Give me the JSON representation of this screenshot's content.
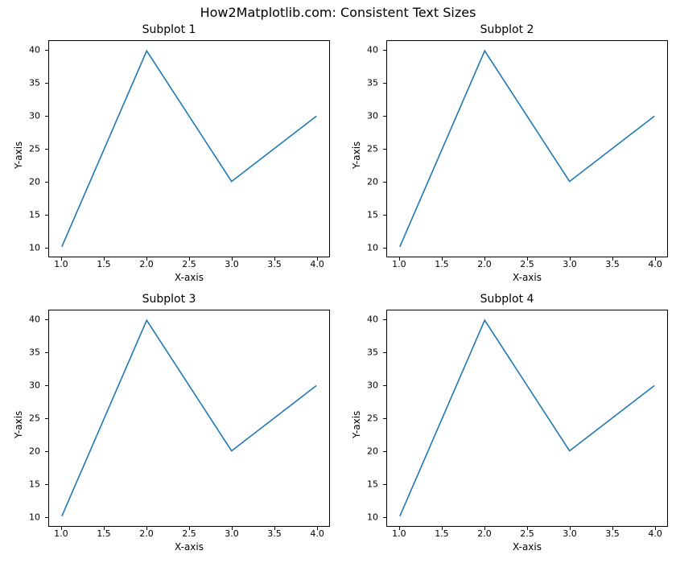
{
  "suptitle": "How2Matplotlib.com: Consistent Text Sizes",
  "xlabel": "X-axis",
  "ylabel": "Y-axis",
  "line_color": "#1f77b4",
  "subplot_titles": [
    "Subplot 1",
    "Subplot 2",
    "Subplot 3",
    "Subplot 4"
  ],
  "xticks": [
    "1.0",
    "1.5",
    "2.0",
    "2.5",
    "3.0",
    "3.5",
    "4.0"
  ],
  "yticks": [
    "10",
    "15",
    "20",
    "25",
    "30",
    "35",
    "40"
  ],
  "xlim": [
    1.0,
    4.0
  ],
  "ylim": [
    10,
    40
  ],
  "chart_data": [
    {
      "type": "line",
      "title": "Subplot 1",
      "xlabel": "X-axis",
      "ylabel": "Y-axis",
      "xlim": [
        1.0,
        4.0
      ],
      "ylim": [
        10,
        40
      ],
      "x": [
        1,
        2,
        3,
        4
      ],
      "y": [
        10,
        40,
        20,
        30
      ]
    },
    {
      "type": "line",
      "title": "Subplot 2",
      "xlabel": "X-axis",
      "ylabel": "Y-axis",
      "xlim": [
        1.0,
        4.0
      ],
      "ylim": [
        10,
        40
      ],
      "x": [
        1,
        2,
        3,
        4
      ],
      "y": [
        10,
        40,
        20,
        30
      ]
    },
    {
      "type": "line",
      "title": "Subplot 3",
      "xlabel": "X-axis",
      "ylabel": "Y-axis",
      "xlim": [
        1.0,
        4.0
      ],
      "ylim": [
        10,
        40
      ],
      "x": [
        1,
        2,
        3,
        4
      ],
      "y": [
        10,
        40,
        20,
        30
      ]
    },
    {
      "type": "line",
      "title": "Subplot 4",
      "xlabel": "X-axis",
      "ylabel": "Y-axis",
      "xlim": [
        1.0,
        4.0
      ],
      "ylim": [
        10,
        40
      ],
      "x": [
        1,
        2,
        3,
        4
      ],
      "y": [
        10,
        40,
        20,
        30
      ]
    }
  ]
}
